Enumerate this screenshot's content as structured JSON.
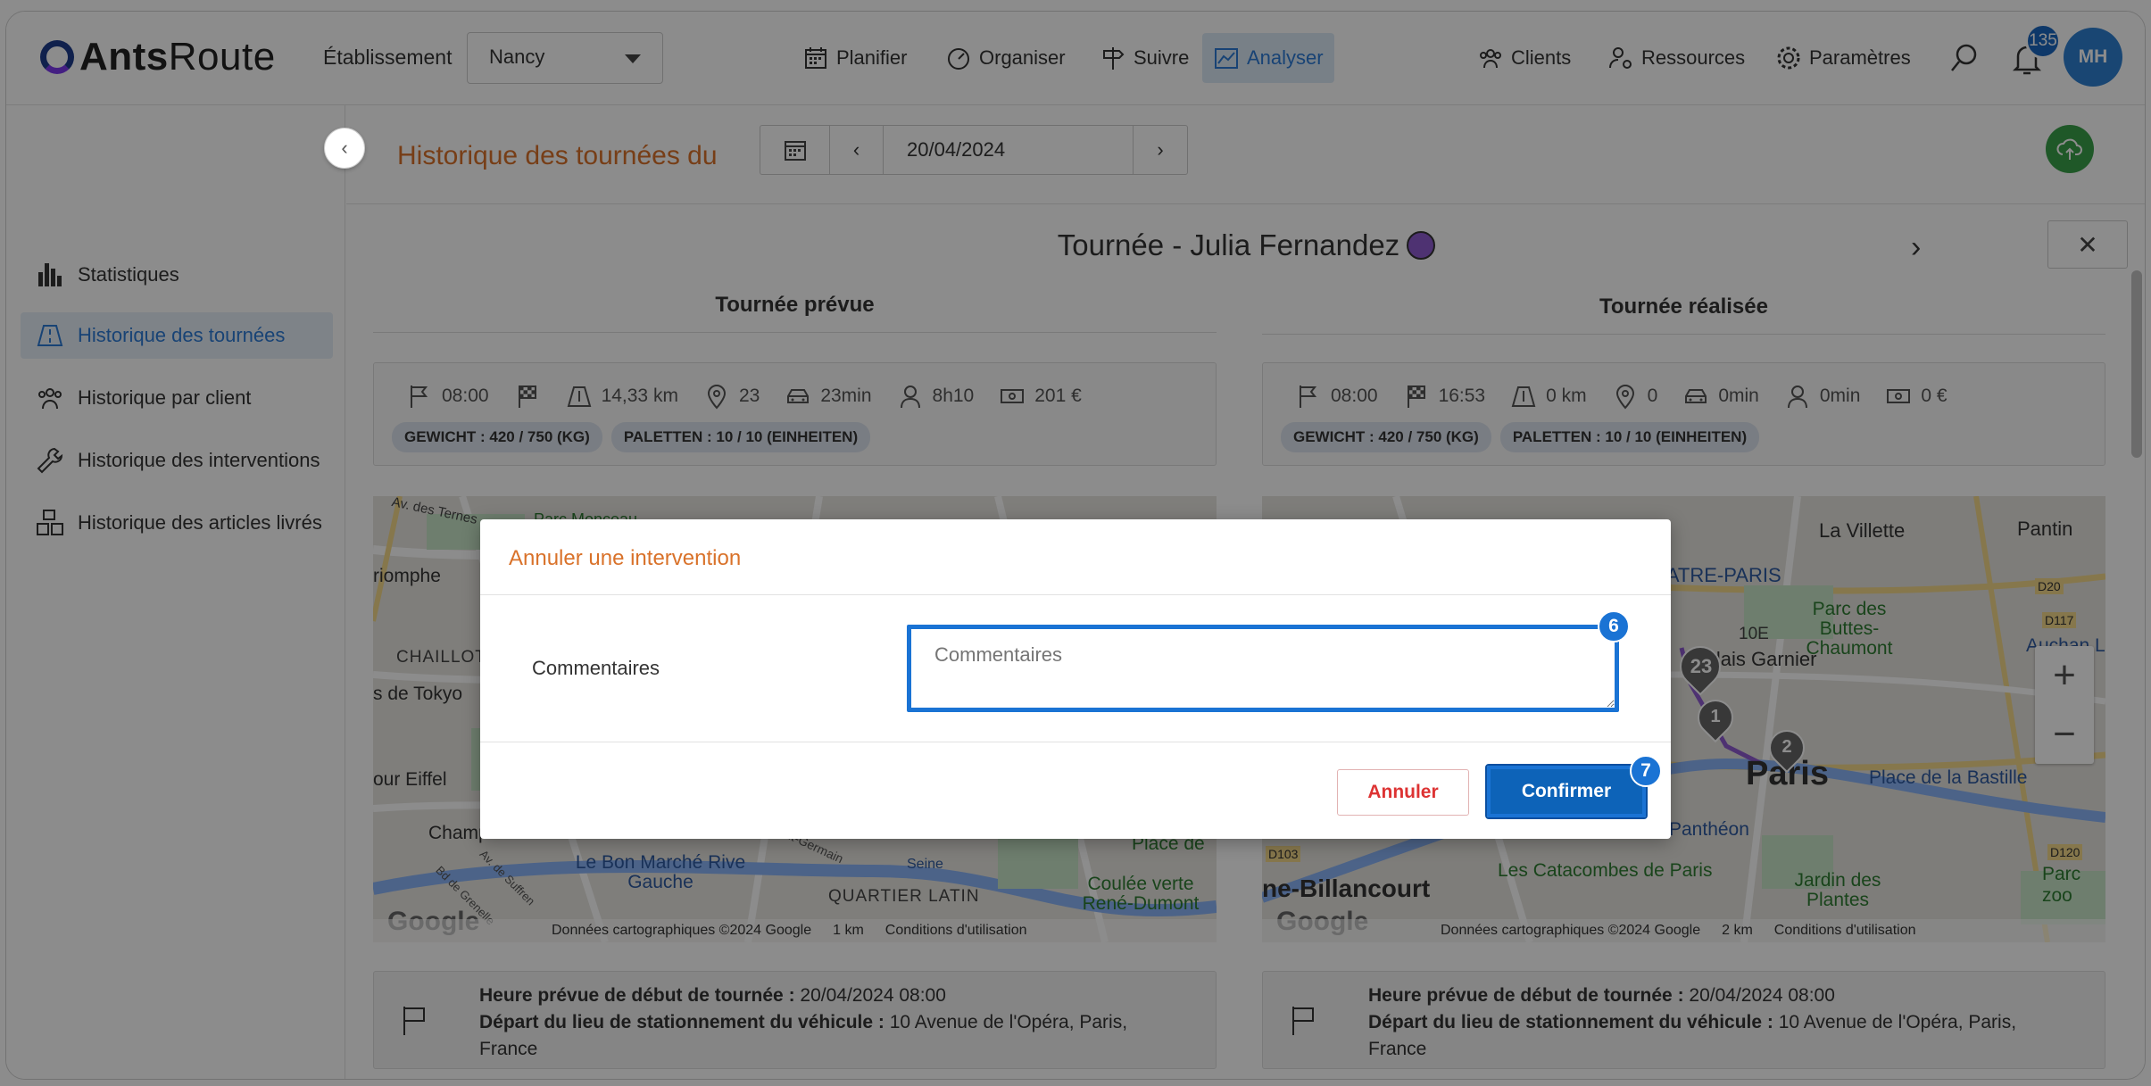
{
  "header": {
    "logo_text_bold": "Ants",
    "logo_text_light": "Route",
    "etablissement_label": "Établissement",
    "etablissement_value": "Nancy",
    "nav": [
      {
        "label": "Planifier",
        "icon": "calendar-icon"
      },
      {
        "label": "Organiser",
        "icon": "gauge-icon"
      },
      {
        "label": "Suivre",
        "icon": "signpost-icon"
      },
      {
        "label": "Analyser",
        "icon": "chart-icon",
        "active": true
      }
    ],
    "right_nav": [
      {
        "label": "Clients",
        "icon": "users-icon"
      },
      {
        "label": "Ressources",
        "icon": "user-gear-icon"
      },
      {
        "label": "Paramètres",
        "icon": "gear-icon"
      }
    ],
    "notification_count": "135",
    "avatar_initials": "MH"
  },
  "sidebar": {
    "items": [
      {
        "label": "Statistiques",
        "icon": "bar-chart-icon"
      },
      {
        "label": "Historique des tournées",
        "icon": "road-icon",
        "active": true
      },
      {
        "label": "Historique par client",
        "icon": "users-icon"
      },
      {
        "label": "Historique des interventions",
        "icon": "wrench-icon"
      },
      {
        "label": "Historique des articles livrés",
        "icon": "boxes-icon"
      }
    ]
  },
  "main": {
    "page_title": "Historique des tournées du",
    "date": "20/04/2024",
    "tour_title": "Tournée - Julia Fernandez",
    "planned": {
      "heading": "Tournée prévue",
      "stats": {
        "start": "08:00",
        "distance": "14,33 km",
        "stops": "23",
        "drive": "23min",
        "duration": "8h10",
        "cost": "201 €"
      },
      "badges": [
        "GEWICHT : 420 / 750 (KG)",
        "PALETTEN : 10 / 10 (EINHEITEN)"
      ],
      "map_footer": {
        "data": "Données cartographiques ©2024 Google",
        "scale": "1 km",
        "terms": "Conditions d'utilisation"
      },
      "map_labels": [
        "Av. des Ternes",
        "Parc Monceau",
        "riomphe",
        "CHAILLOT",
        "s de Tokyo",
        "our Eiffel",
        "Champ de Mars",
        "Le Bon Marché Rive Gauche",
        "QUARTIER LATIN",
        "Coulée verte René-Dumont",
        "Place de",
        "Seine",
        "Saint-Germain",
        "Av. de Suffren",
        "Bd de Grenelle"
      ],
      "info_label1": "Heure prévue de début de tournée :",
      "info_value1": "20/04/2024 08:00",
      "info_label2": "Départ du lieu de stationnement du véhicule :",
      "info_value2": "10 Avenue de l'Opéra, Paris, France"
    },
    "actual": {
      "heading": "Tournée réalisée",
      "stats": {
        "start": "08:00",
        "finish": "16:53",
        "distance": "0 km",
        "stops": "0",
        "drive": "0min",
        "duration": "0min",
        "cost": "0 €"
      },
      "badges": [
        "GEWICHT : 420 / 750 (KG)",
        "PALETTEN : 10 / 10 (EINHEITEN)"
      ],
      "map_footer": {
        "data": "Données cartographiques ©2024 Google",
        "scale": "2 km",
        "terms": "Conditions d'utilisation"
      },
      "map_labels": [
        "La Villette",
        "Pantin",
        "CENTQUATRE-PARIS",
        "Parc des Buttes-Chaumont",
        "10E",
        "Palais Garnier",
        "Auchan L",
        "Paris",
        "Place de la Bastille",
        "Panthéon",
        "Les Catacombes de Paris",
        "Jardin des Plantes",
        "Parc zoo",
        "ne-Billancourt",
        "D20",
        "D117",
        "D103",
        "D120"
      ],
      "markers": [
        "23",
        "1",
        "2"
      ],
      "info_label1": "Heure prévue de début de tournée :",
      "info_value1": "20/04/2024 08:00",
      "info_label2": "Départ du lieu de stationnement du véhicule :",
      "info_value2": "10 Avenue de l'Opéra, Paris, France"
    }
  },
  "modal": {
    "title": "Annuler une intervention",
    "comment_label": "Commentaires",
    "comment_placeholder": "Commentaires",
    "comment_value": "",
    "step_comment": "6",
    "step_confirm": "7",
    "cancel_label": "Annuler",
    "confirm_label": "Confirmer"
  },
  "colors": {
    "accent": "#d9722a",
    "primary": "#1a73d4",
    "active_nav": "#2c7ad6",
    "success": "#3aa04a",
    "danger": "#d33333"
  }
}
